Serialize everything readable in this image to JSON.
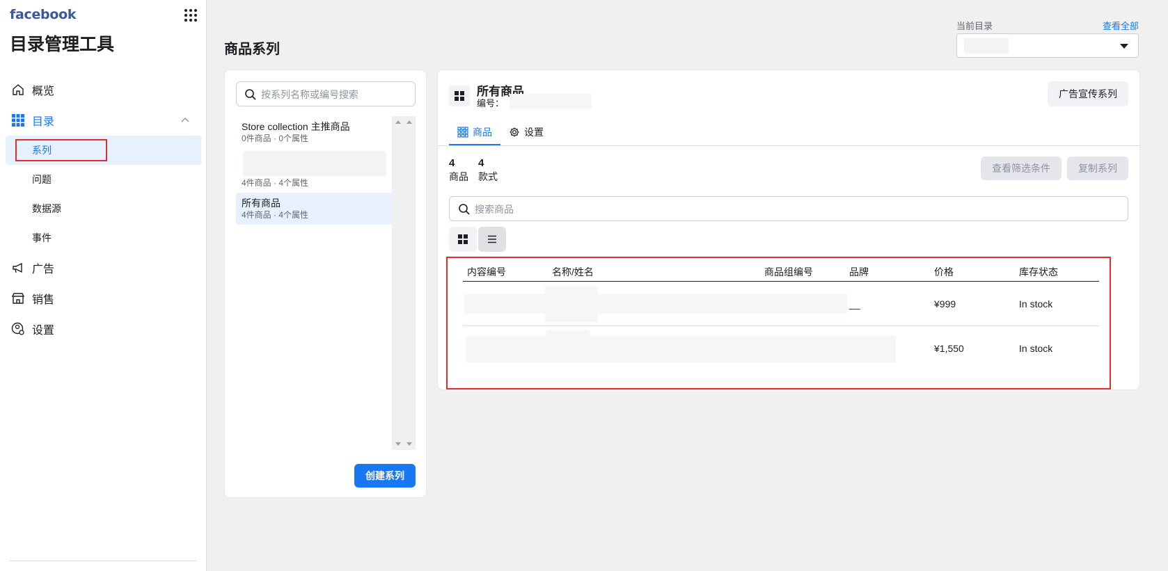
{
  "sidebar": {
    "brand": "facebook",
    "app_title": "目录管理工具",
    "nav": [
      {
        "label": "概览",
        "icon": "home-icon"
      },
      {
        "label": "目录",
        "icon": "grid-icon"
      },
      {
        "label": "广告",
        "icon": "megaphone-icon"
      },
      {
        "label": "销售",
        "icon": "storefront-icon"
      },
      {
        "label": "设置",
        "icon": "gear-user-icon"
      }
    ],
    "catalog_sub": [
      "系列",
      "问题",
      "数据源",
      "事件"
    ]
  },
  "header": {
    "page_title": "商品系列",
    "catalog_label": "当前目录",
    "view_all": "查看全部"
  },
  "sets_panel": {
    "search_placeholder": "按系列名称或编号搜索",
    "items": [
      {
        "name": "Store collection 主推商品",
        "meta": "0件商品 · 0个属性"
      },
      {
        "name": "",
        "meta": "4件商品 · 4个属性"
      },
      {
        "name": "所有商品",
        "meta": "4件商品 · 4个属性"
      }
    ],
    "create_button": "创建系列"
  },
  "detail": {
    "title": "所有商品",
    "id_label": "编号：",
    "promo_button": "广告宣传系列",
    "tabs": [
      {
        "label": "商品",
        "icon": "grid-small-icon"
      },
      {
        "label": "设置",
        "icon": "gear-icon"
      }
    ],
    "stats": [
      {
        "num": "4",
        "label": "商品"
      },
      {
        "num": "4",
        "label": "款式"
      }
    ],
    "filter_button": "查看筛选条件",
    "copy_button": "复制系列",
    "product_search_placeholder": "搜索商品",
    "table": {
      "headers": [
        "内容编号",
        "名称/姓名",
        "商品组编号",
        "品牌",
        "价格",
        "库存状态"
      ],
      "rows": [
        {
          "brand": "__",
          "price": "¥999",
          "stock": "In stock"
        },
        {
          "brand": "",
          "price": "¥1,550",
          "stock": "In stock"
        }
      ]
    }
  },
  "colors": {
    "accent": "#1877f2",
    "highlight_border": "#e02d2d",
    "selected_bg": "#e7f0fd"
  }
}
